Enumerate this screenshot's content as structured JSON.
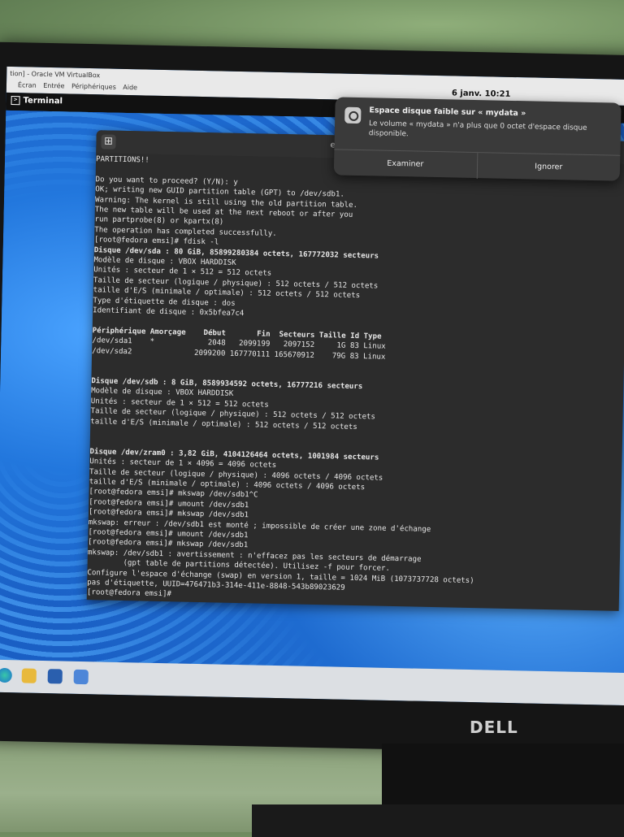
{
  "vbox": {
    "window_title": "tion] - Oracle VM VirtualBox",
    "menus": [
      "Écran",
      "Entrée",
      "Périphériques",
      "Aide"
    ]
  },
  "gnome": {
    "app_name": "Terminal",
    "clock": "6 janv.  10:21"
  },
  "terminal": {
    "title": "e",
    "lines": [
      {
        "text": "PARTITIONS!!",
        "bold": false
      },
      {
        "text": "",
        "bold": false
      },
      {
        "text": "Do you want to proceed? (Y/N): y",
        "bold": false
      },
      {
        "text": "OK; writing new GUID partition table (GPT) to /dev/sdb1.",
        "bold": false
      },
      {
        "text": "Warning: The kernel is still using the old partition table.",
        "bold": false
      },
      {
        "text": "The new table will be used at the next reboot or after you",
        "bold": false
      },
      {
        "text": "run partprobe(8) or kpartx(8)",
        "bold": false
      },
      {
        "text": "The operation has completed successfully.",
        "bold": false
      },
      {
        "text": "[root@fedora emsi]# fdisk -l",
        "bold": false
      },
      {
        "text": "Disque /dev/sda : 80 GiB, 85899280384 octets, 167772032 secteurs",
        "bold": true
      },
      {
        "text": "Modèle de disque : VBOX HARDDISK",
        "bold": false
      },
      {
        "text": "Unités : secteur de 1 × 512 = 512 octets",
        "bold": false
      },
      {
        "text": "Taille de secteur (logique / physique) : 512 octets / 512 octets",
        "bold": false
      },
      {
        "text": "taille d'E/S (minimale / optimale) : 512 octets / 512 octets",
        "bold": false
      },
      {
        "text": "Type d'étiquette de disque : dos",
        "bold": false
      },
      {
        "text": "Identifiant de disque : 0x5bfea7c4",
        "bold": false
      },
      {
        "text": "",
        "bold": false
      },
      {
        "text": "Périphérique Amorçage    Début       Fin  Secteurs Taille Id Type",
        "bold": true
      },
      {
        "text": "/dev/sda1    *            2048   2099199   2097152     1G 83 Linux",
        "bold": false
      },
      {
        "text": "/dev/sda2              2099200 167770111 165670912    79G 83 Linux",
        "bold": false
      },
      {
        "text": "",
        "bold": false
      },
      {
        "text": "",
        "bold": false
      },
      {
        "text": "Disque /dev/sdb : 8 GiB, 8589934592 octets, 16777216 secteurs",
        "bold": true
      },
      {
        "text": "Modèle de disque : VBOX HARDDISK",
        "bold": false
      },
      {
        "text": "Unités : secteur de 1 × 512 = 512 octets",
        "bold": false
      },
      {
        "text": "Taille de secteur (logique / physique) : 512 octets / 512 octets",
        "bold": false
      },
      {
        "text": "taille d'E/S (minimale / optimale) : 512 octets / 512 octets",
        "bold": false
      },
      {
        "text": "",
        "bold": false
      },
      {
        "text": "",
        "bold": false
      },
      {
        "text": "Disque /dev/zram0 : 3,82 GiB, 4104126464 octets, 1001984 secteurs",
        "bold": true
      },
      {
        "text": "Unités : secteur de 1 × 4096 = 4096 octets",
        "bold": false
      },
      {
        "text": "Taille de secteur (logique / physique) : 4096 octets / 4096 octets",
        "bold": false
      },
      {
        "text": "taille d'E/S (minimale / optimale) : 4096 octets / 4096 octets",
        "bold": false
      },
      {
        "text": "[root@fedora emsi]# mkswap /dev/sdb1^C",
        "bold": false
      },
      {
        "text": "[root@fedora emsi]# umount /dev/sdb1",
        "bold": false
      },
      {
        "text": "[root@fedora emsi]# mkswap /dev/sdb1",
        "bold": false
      },
      {
        "text": "mkswap: erreur : /dev/sdb1 est monté ; impossible de créer une zone d'échange",
        "bold": false
      },
      {
        "text": "[root@fedora emsi]# umount /dev/sdb1",
        "bold": false
      },
      {
        "text": "[root@fedora emsi]# mkswap /dev/sdb1",
        "bold": false
      },
      {
        "text": "mkswap: /dev/sdb1 : avertissement : n'effacez pas les secteurs de démarrage",
        "bold": false
      },
      {
        "text": "        (gpt table de partitions détectée). Utilisez -f pour forcer.",
        "bold": false
      },
      {
        "text": "Configure l'espace d'échange (swap) en version 1, taille = 1024 MiB (1073737728 octets)",
        "bold": false
      },
      {
        "text": "pas d'étiquette, UUID=476471b3-314e-411e-8848-543b89023629",
        "bold": false
      },
      {
        "text": "[root@fedora emsi]#",
        "bold": false
      }
    ]
  },
  "notification": {
    "title": "Espace disque faible sur « mydata »",
    "message": "Le volume « mydata » n'a plus que 0 octet d'espace disque disponible.",
    "button_examine": "Examiner",
    "button_ignore": "Ignorer",
    "icon": "disk-icon"
  },
  "taskbar": {
    "icons": [
      "edge-icon",
      "folder-icon",
      "virtualbox-icon",
      "fedora-icon"
    ]
  },
  "monitor": {
    "brand": "DELL"
  }
}
